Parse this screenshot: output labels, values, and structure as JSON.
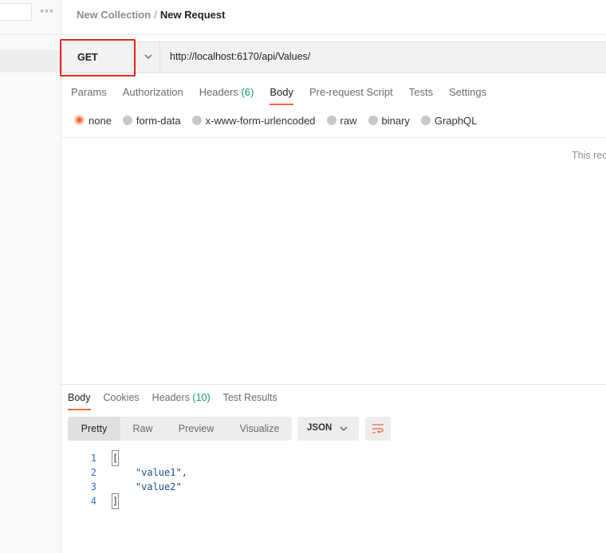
{
  "sidebar": {
    "more_icon": "ellipsis-icon",
    "more_glyph": "∘∘∘"
  },
  "breadcrumb": {
    "collection": "New Collection",
    "separator": "/",
    "request": "New Request"
  },
  "request": {
    "method": "GET",
    "url": "http://localhost:6170/api/Values/"
  },
  "request_tabs": {
    "params": "Params",
    "authorization": "Authorization",
    "headers": "Headers",
    "headers_count": "(6)",
    "body": "Body",
    "prerequest": "Pre-request Script",
    "tests": "Tests",
    "settings": "Settings",
    "active": "Body"
  },
  "body_types": {
    "none": "none",
    "form_data": "form-data",
    "urlencoded": "x-www-form-urlencoded",
    "raw": "raw",
    "binary": "binary",
    "graphql": "GraphQL",
    "selected": "none"
  },
  "body_hint": "This rec",
  "response_tabs": {
    "body": "Body",
    "cookies": "Cookies",
    "headers": "Headers",
    "headers_count": "(10)",
    "test_results": "Test Results",
    "active": "Body"
  },
  "response_view": {
    "pretty": "Pretty",
    "raw": "Raw",
    "preview": "Preview",
    "visualize": "Visualize",
    "active": "Pretty",
    "format": "JSON"
  },
  "response_body": {
    "lines": [
      {
        "num": "1",
        "text": "["
      },
      {
        "num": "2",
        "text": "    \"value1\","
      },
      {
        "num": "3",
        "text": "    \"value2\""
      },
      {
        "num": "4",
        "text": "]"
      }
    ]
  },
  "colors": {
    "accent": "#f26b3a",
    "highlight_box": "#e8221f",
    "count": "#0f9d58"
  }
}
